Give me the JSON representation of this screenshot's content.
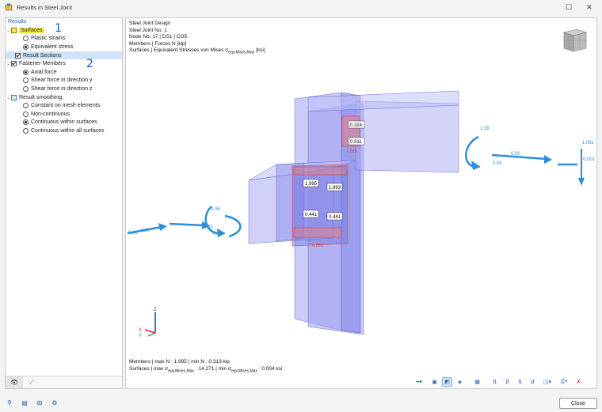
{
  "window": {
    "title": "Results in Steel Joint",
    "close_label": "Close"
  },
  "tree": {
    "header": "Results",
    "surfaces": {
      "label": "Surfaces",
      "options": [
        "Plastic strains",
        "Equivalent stress"
      ],
      "selected": "Equivalent stress"
    },
    "result_sections": {
      "label": "Result Sections"
    },
    "fastener_members": {
      "label": "Fastener Members",
      "options": [
        "Axial force",
        "Shear force in direction y",
        "Shear force in direction z"
      ],
      "selected": "Axial force"
    },
    "result_smoothing": {
      "label": "Result smoothing",
      "options": [
        "Constant on mesh elements",
        "Non-continuous",
        "Continuous within surfaces",
        "Continuous within all surfaces"
      ],
      "selected": "Continuous within surfaces"
    },
    "badges": [
      "1",
      "2"
    ]
  },
  "info": {
    "line1": "Steel Joint Design",
    "line2": "Steel Joint No. 1",
    "line3": "Node No. 17 | DS1 | CO5",
    "line4": "Members | Forces N [kip]",
    "line5_prefix": "Surfaces | Equivalent Stresses von Mises σ",
    "line5_sub": "eqv,Mises,Max",
    "line5_unit": " [ksi]"
  },
  "bottom": {
    "line1": "Members | max N : 1.995 | min N : 0.313 kip",
    "line2_a": "Surfaces | max σ",
    "line2_sub1": "eqv,Mises,Max",
    "line2_b": " : 14.271 | min σ",
    "line2_sub2": "eqv,Mises,Max",
    "line2_c": " : 0.004 ksi"
  },
  "result_labels": {
    "white_boxes": [
      "0.324",
      "0.311",
      "1.995",
      "1.993",
      "0.441",
      "0.441"
    ],
    "force_labels": [
      "1.39",
      "0.00",
      "0.00",
      "1.081",
      "0.001",
      "0.06",
      "0.00",
      "0.11",
      "0.00",
      "0.00"
    ],
    "stress_labels": [
      "6.683",
      "7.025"
    ]
  },
  "axes": {
    "x": "X",
    "y": "Y",
    "z": "Z"
  },
  "colors": {
    "accent": "#2b8fd6",
    "plate": "#8c8ef0",
    "stress": "#e05a5a",
    "selected": "#cfe3f8"
  }
}
